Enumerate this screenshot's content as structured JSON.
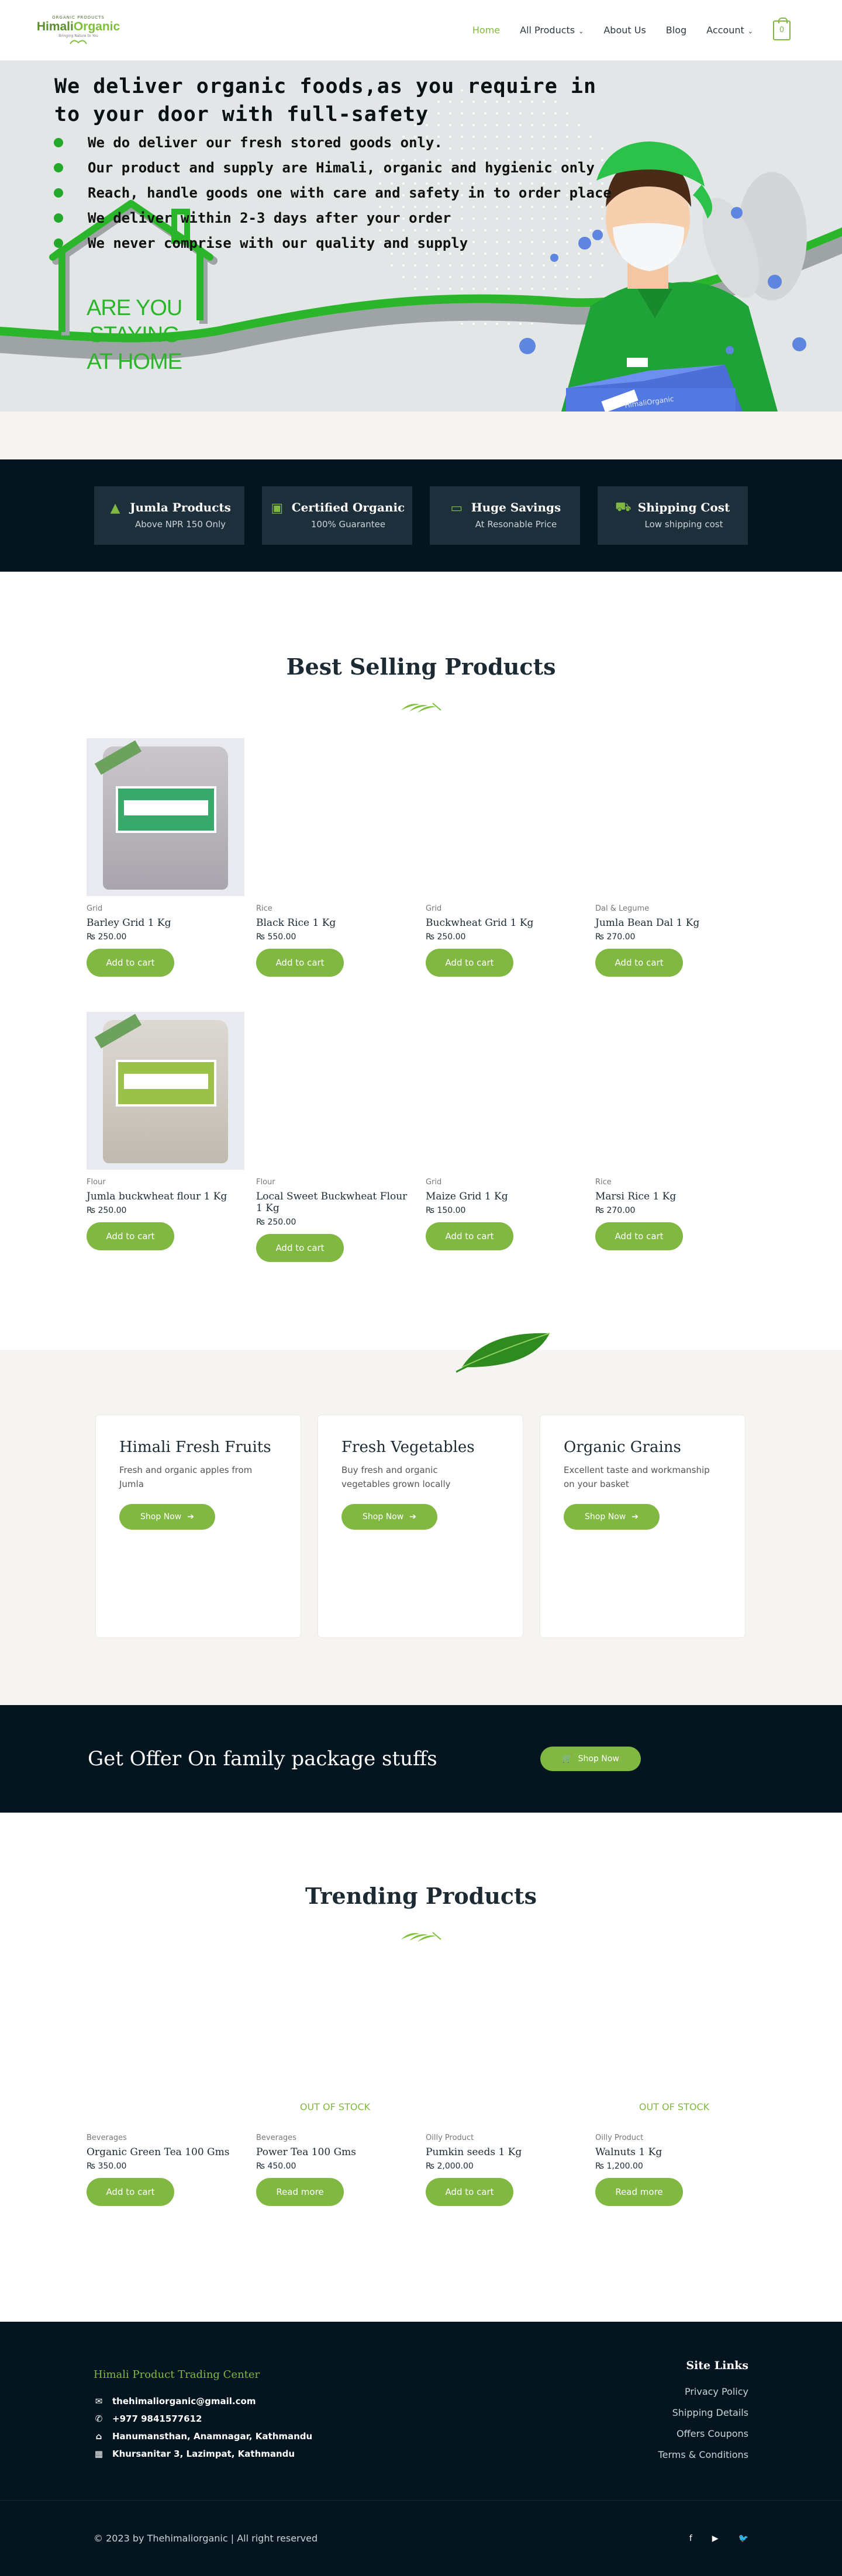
{
  "header": {
    "logo_top": "ORGANIC PRODUCTS",
    "logo_main_a": "Himali",
    "logo_main_b": "Organic",
    "logo_sub": "Bringing Nature to You",
    "nav": {
      "home": "Home",
      "all_products": "All Products",
      "about": "About Us",
      "blog": "Blog",
      "account": "Account"
    },
    "cart_count": "0",
    "colors": {
      "accent": "#80b841",
      "dark": "#041520"
    }
  },
  "hero": {
    "title": "We deliver organic foods,as you require in to your door with full-safety",
    "points": [
      "We do deliver our fresh stored goods only.",
      "Our product and supply are Himali, organic and  hygienic only",
      "Reach, handle goods one with care and safety in to order place",
      "We deliver within 2-3 days after your order",
      "We never comprise with our quality and supply"
    ],
    "house_text": [
      "ARE YOU",
      "STAYING",
      "AT HOME"
    ],
    "box_label": "HimaliOrganic"
  },
  "features": [
    {
      "icon": "triangle-icon",
      "title": "Jumla Products",
      "sub": "Above NPR 150 Only"
    },
    {
      "icon": "certificate-icon",
      "title": "Certified Organic",
      "sub": "100% Guarantee"
    },
    {
      "icon": "money-icon",
      "title": "Huge Savings",
      "sub": "At Resonable Price"
    },
    {
      "icon": "truck-icon",
      "title": "Shipping Cost",
      "sub": "Low shipping cost"
    }
  ],
  "best_selling": {
    "title": "Best Selling Products",
    "products": [
      {
        "cat": "Grid",
        "name": "Barley Grid 1 Kg",
        "price": "₨ 250.00",
        "button": "Add to cart"
      },
      {
        "cat": "Rice",
        "name": "Black Rice 1 Kg",
        "price": "₨ 550.00",
        "button": "Add to cart"
      },
      {
        "cat": "Grid",
        "name": "Buckwheat Grid 1 Kg",
        "price": "₨ 250.00",
        "button": "Add to cart"
      },
      {
        "cat": "Dal & Legume",
        "name": "Jumla Bean Dal 1 Kg",
        "price": "₨ 270.00",
        "button": "Add to cart"
      },
      {
        "cat": "Flour",
        "name": "Jumla buckwheat flour 1 Kg",
        "price": "₨ 250.00",
        "button": "Add to cart"
      },
      {
        "cat": "Flour",
        "name": "Local Sweet Buckwheat Flour 1 Kg",
        "price": "₨ 250.00",
        "button": "Add to cart"
      },
      {
        "cat": "Grid",
        "name": "Maize Grid 1 Kg",
        "price": "₨ 150.00",
        "button": "Add to cart"
      },
      {
        "cat": "Rice",
        "name": "Marsi Rice 1 Kg",
        "price": "₨ 270.00",
        "button": "Add to cart"
      }
    ]
  },
  "categories": [
    {
      "title": "Himali Fresh Fruits",
      "desc": "Fresh and organic apples from Jumla",
      "button": "Shop Now"
    },
    {
      "title": "Fresh Vegetables",
      "desc": "Buy fresh and organic vegetables grown locally",
      "button": "Shop Now"
    },
    {
      "title": "Organic Grains",
      "desc": "Excellent taste and workmanship on your basket",
      "button": "Shop Now"
    }
  ],
  "offer": {
    "title": "Get Offer On family package stuffs",
    "button": "Shop Now"
  },
  "trending": {
    "title": "Trending Products",
    "out_of_stock": "OUT OF STOCK",
    "products": [
      {
        "cat": "Beverages",
        "name": "Organic Green Tea 100 Gms",
        "price": "₨ 350.00",
        "button": "Add to cart",
        "oos": false
      },
      {
        "cat": "Beverages",
        "name": "Power Tea 100 Gms",
        "price": "₨ 450.00",
        "button": "Read more",
        "oos": true
      },
      {
        "cat": "Oilly Product",
        "name": "Pumkin seeds 1 Kg",
        "price": "₨ 2,000.00",
        "button": "Add to cart",
        "oos": false
      },
      {
        "cat": "Oilly Product",
        "name": "Walnuts 1 Kg",
        "price": "₨ 1,200.00",
        "button": "Read more",
        "oos": true
      }
    ]
  },
  "footer": {
    "company": "Himali Product Trading Center",
    "email": "thehimaliorganic@gmail.com",
    "phone": "+977 9841577612",
    "address1": "Hanumansthan, Anamnagar, Kathmandu",
    "address2": "Khursanitar 3, Lazimpat, Kathmandu",
    "links_title": "Site Links",
    "links": [
      "Privacy Policy",
      "Shipping Details",
      "Offers Coupons",
      "Terms & Conditions"
    ],
    "copyright": "© 2023 by Thehimaliorganic | All right reserved",
    "social": [
      "f",
      "▶",
      "🐦"
    ]
  }
}
